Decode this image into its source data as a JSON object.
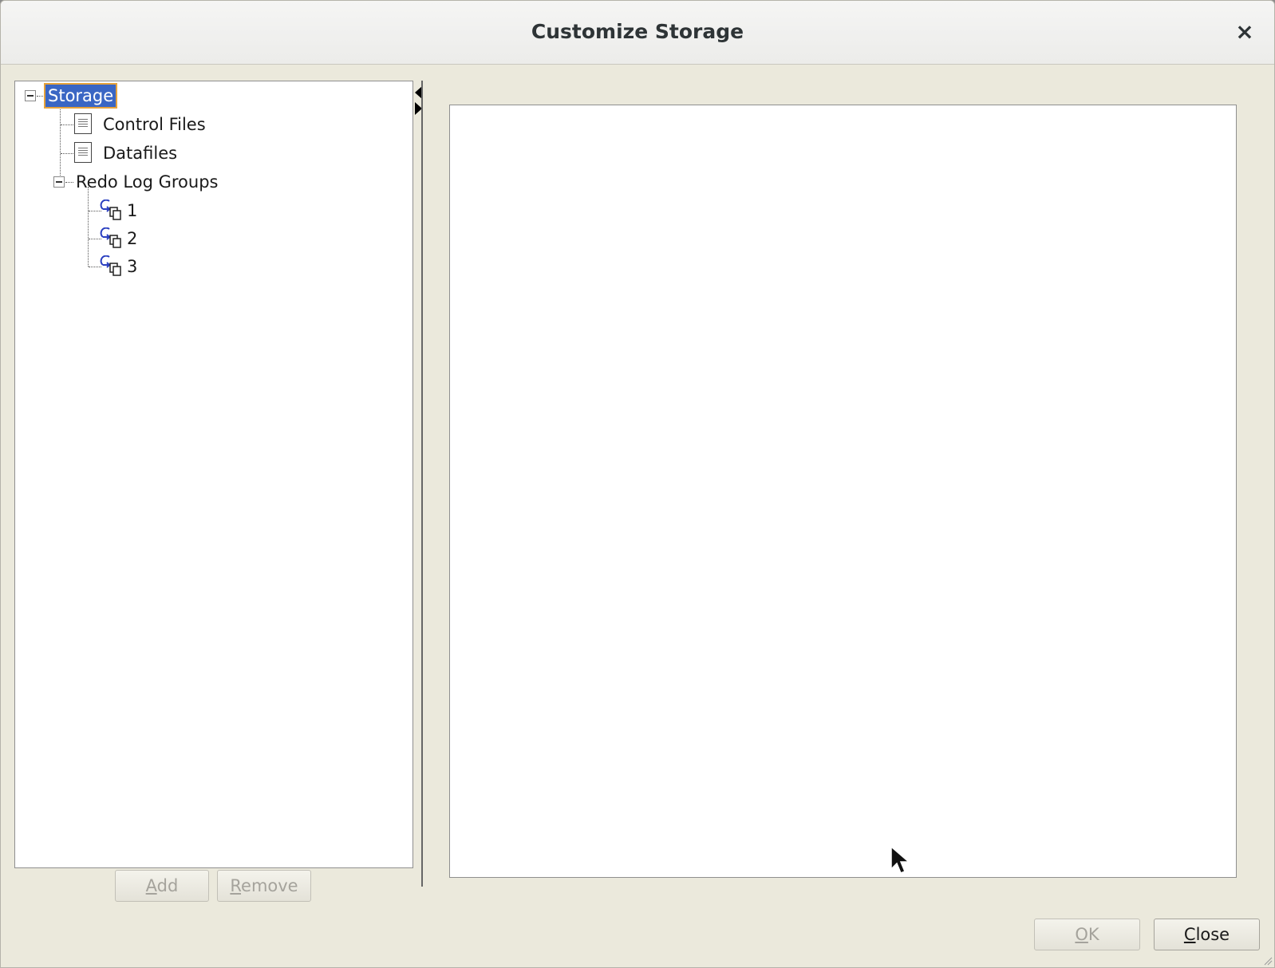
{
  "dialog": {
    "title": "Customize Storage",
    "close_glyph": "×"
  },
  "tree": {
    "root": {
      "label": "Storage",
      "selected": true,
      "expanded": true,
      "icon": "minus-expander-icon"
    },
    "items": [
      {
        "label": "Control Files",
        "icon": "control-files-icon"
      },
      {
        "label": "Datafiles",
        "icon": "datafiles-icon"
      },
      {
        "label": "Redo Log Groups",
        "icon": "minus-expander-icon",
        "expanded": true
      }
    ],
    "log_groups": [
      {
        "label": "1",
        "icon": "redo-log-icon"
      },
      {
        "label": "2",
        "icon": "redo-log-icon"
      },
      {
        "label": "3",
        "icon": "redo-log-icon"
      }
    ]
  },
  "tree_buttons": {
    "add": {
      "mnemonic": "A",
      "rest": "dd",
      "enabled": false
    },
    "remove": {
      "mnemonic": "R",
      "rest": "emove",
      "enabled": false
    }
  },
  "footer_buttons": {
    "ok": {
      "mnemonic": "O",
      "rest": "K",
      "enabled": false
    },
    "close": {
      "mnemonic": "C",
      "rest": "lose",
      "enabled": true
    }
  },
  "colors": {
    "window_bg": "#ebe9dc",
    "selection_bg": "#3a66c4",
    "selection_outline": "#e6a23c",
    "icon_blue": "#2a3fc0"
  }
}
